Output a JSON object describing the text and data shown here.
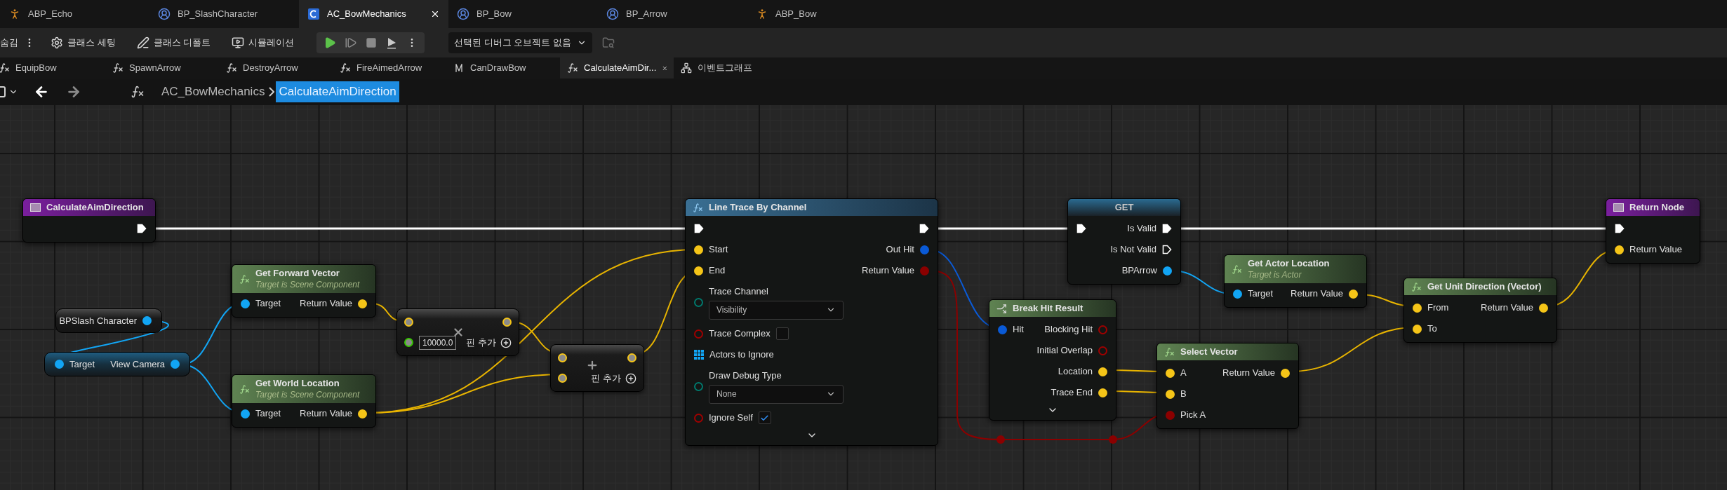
{
  "asset_tabs": [
    {
      "label": "ABP_Echo",
      "kind": "anim",
      "selected": false
    },
    {
      "label": "BP_SlashCharacter",
      "kind": "blueprint",
      "selected": false
    },
    {
      "label": "AC_BowMechanics",
      "kind": "component",
      "selected": true
    },
    {
      "label": "BP_Bow",
      "kind": "blueprint",
      "selected": false
    },
    {
      "label": "BP_Arrow",
      "kind": "blueprint",
      "selected": false
    },
    {
      "label": "ABP_Bow",
      "kind": "anim",
      "selected": false
    }
  ],
  "toolbar": {
    "hide_label": "숨김",
    "buttons": [
      {
        "label": "클래스 세팅",
        "kind": "settings"
      },
      {
        "label": "클래스 디폴트",
        "kind": "defaults"
      },
      {
        "label": "시뮬레이션",
        "kind": "simulate"
      }
    ],
    "debug_object": "선택된 디버그 오브젝트 없음"
  },
  "graph_tabs": [
    {
      "label": "EquipBow",
      "kind": "function",
      "selected": false
    },
    {
      "label": "SpawnArrow",
      "kind": "function",
      "selected": false
    },
    {
      "label": "DestroyArrow",
      "kind": "function",
      "selected": false
    },
    {
      "label": "FireAimedArrow",
      "kind": "function",
      "selected": false
    },
    {
      "label": "CanDrawBow",
      "kind": "macro",
      "selected": false
    },
    {
      "label": "CalculateAimDir...",
      "kind": "function",
      "selected": true
    },
    {
      "label": "이벤트그래프",
      "kind": "event_graph",
      "selected": false
    }
  ],
  "breadcrumb": {
    "parent": "AC_BowMechanics",
    "current": "CalculateAimDirection"
  },
  "graph": {
    "nodes": [
      {
        "kind": "entry",
        "title": "CalculateAimDirection",
        "outputs": [
          {
            "kind": "exec",
            "connected": true
          }
        ]
      },
      {
        "kind": "variable",
        "outputs": [
          {
            "label": "BPSlash Character",
            "kind": "object",
            "connected": true
          }
        ]
      },
      {
        "kind": "member",
        "inputs": [
          {
            "label": "Target",
            "kind": "object",
            "connected": true
          }
        ],
        "outputs": [
          {
            "label": "View Camera",
            "kind": "object",
            "connected": true
          }
        ]
      },
      {
        "kind": "pure",
        "title": "Get Forward Vector",
        "subtitle": "Target is Scene Component",
        "inputs": [
          {
            "label": "Target",
            "kind": "object",
            "connected": true
          }
        ],
        "outputs": [
          {
            "label": "Return Value",
            "kind": "vector",
            "connected": true
          }
        ]
      },
      {
        "kind": "pure",
        "title": "Get World Location",
        "subtitle": "Target is Scene Component",
        "inputs": [
          {
            "label": "Target",
            "kind": "object",
            "connected": true
          }
        ],
        "outputs": [
          {
            "label": "Return Value",
            "kind": "vector",
            "connected": true
          }
        ]
      },
      {
        "kind": "multiply",
        "add_pin": "핀 추가",
        "inputs": [
          {
            "kind": "wildcard",
            "connected": true
          },
          {
            "kind": "float",
            "connected": false,
            "value": "10000.0"
          }
        ],
        "outputs": [
          {
            "kind": "wildcard",
            "connected": true
          }
        ]
      },
      {
        "kind": "add",
        "add_pin": "핀 추가",
        "inputs": [
          {
            "kind": "wildcard",
            "connected": true
          },
          {
            "kind": "wildcard",
            "connected": true
          }
        ],
        "outputs": [
          {
            "kind": "wildcard",
            "connected": true
          }
        ]
      },
      {
        "kind": "impure",
        "title": "Line Trace By Channel",
        "expandable": true,
        "inputs": [
          {
            "kind": "exec",
            "connected": true
          },
          {
            "label": "Start",
            "kind": "vector",
            "connected": true
          },
          {
            "label": "End",
            "kind": "vector",
            "connected": true
          },
          {
            "label": "Trace Channel",
            "kind": "enum",
            "connected": false,
            "value": "Visibility"
          },
          {
            "label": "Trace Complex",
            "kind": "bool",
            "connected": false,
            "checked": false
          },
          {
            "label": "Actors to Ignore",
            "kind": "array"
          },
          {
            "label": "Draw Debug Type",
            "kind": "enum",
            "connected": false,
            "value": "None"
          },
          {
            "label": "Ignore Self",
            "kind": "bool",
            "connected": false,
            "checked": true
          }
        ],
        "outputs": [
          {
            "kind": "exec",
            "connected": true
          },
          {
            "label": "Out Hit",
            "kind": "struct",
            "connected": true
          },
          {
            "label": "Return Value",
            "kind": "bool",
            "connected": true
          }
        ]
      },
      {
        "kind": "validated_get",
        "title": "GET",
        "inputs": [
          {
            "kind": "exec",
            "connected": true
          }
        ],
        "outputs": [
          {
            "label": "Is Valid",
            "kind": "exec",
            "connected": true
          },
          {
            "label": "Is Not Valid",
            "kind": "exec",
            "connected": false
          },
          {
            "label": "BPArrow",
            "kind": "object",
            "connected": true
          }
        ]
      },
      {
        "kind": "pure",
        "title": "Get Actor Location",
        "subtitle": "Target is Actor",
        "inputs": [
          {
            "label": "Target",
            "kind": "object",
            "connected": true
          }
        ],
        "outputs": [
          {
            "label": "Return Value",
            "kind": "vector",
            "connected": true
          }
        ]
      },
      {
        "kind": "break",
        "title": "Break Hit Result",
        "expandable": true,
        "inputs": [
          {
            "label": "Hit",
            "kind": "struct",
            "connected": true
          }
        ],
        "outputs": [
          {
            "label": "Blocking Hit",
            "kind": "bool",
            "connected": false
          },
          {
            "label": "Initial Overlap",
            "kind": "bool",
            "connected": false
          },
          {
            "label": "Location",
            "kind": "vector",
            "connected": true
          },
          {
            "label": "Trace End",
            "kind": "vector",
            "connected": true
          }
        ]
      },
      {
        "kind": "pure",
        "title": "Select Vector",
        "inputs": [
          {
            "label": "A",
            "kind": "vector",
            "connected": true
          },
          {
            "label": "B",
            "kind": "vector",
            "connected": true
          },
          {
            "label": "Pick A",
            "kind": "bool",
            "connected": true
          }
        ],
        "outputs": [
          {
            "label": "Return Value",
            "kind": "vector",
            "connected": true
          }
        ]
      },
      {
        "kind": "pure",
        "title": "Get Unit Direction (Vector)",
        "inputs": [
          {
            "label": "From",
            "kind": "vector",
            "connected": true
          },
          {
            "label": "To",
            "kind": "vector",
            "connected": true
          }
        ],
        "outputs": [
          {
            "label": "Return Value",
            "kind": "vector",
            "connected": true
          }
        ]
      },
      {
        "kind": "return",
        "title": "Return Node",
        "inputs": [
          {
            "kind": "exec",
            "connected": true
          },
          {
            "label": "Return Value",
            "kind": "vector",
            "connected": true
          }
        ]
      }
    ]
  }
}
